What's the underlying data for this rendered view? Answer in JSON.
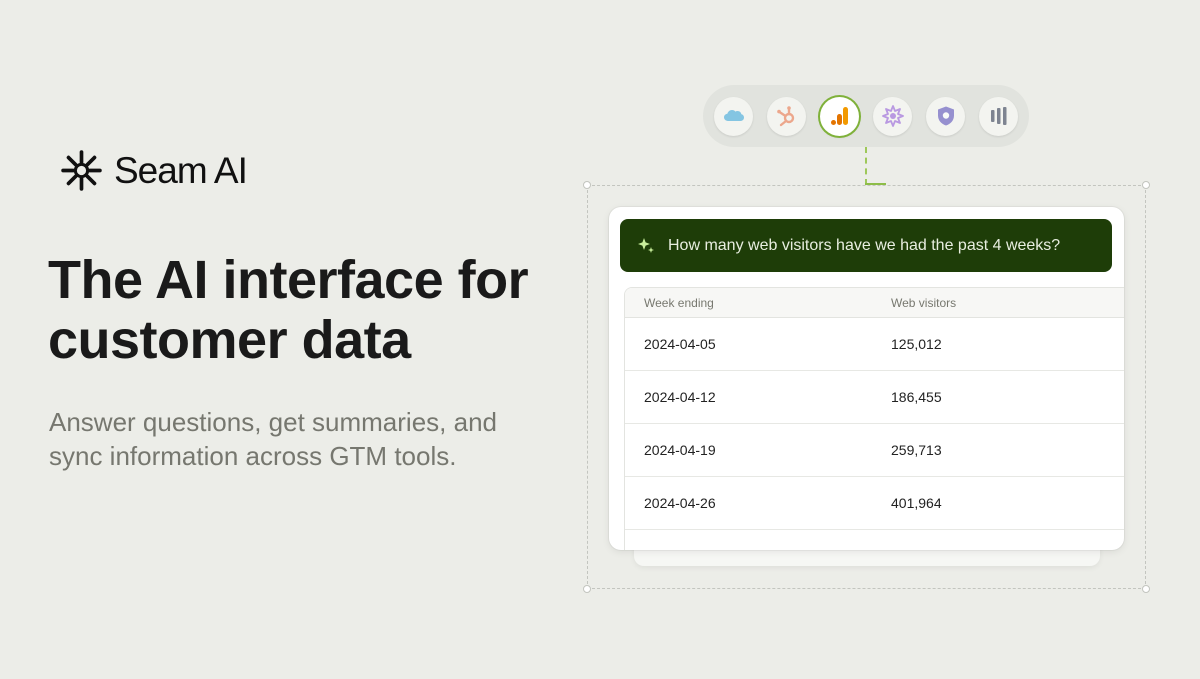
{
  "brand": {
    "name": "Seam AI",
    "logo_icon": "asterisk-burst-logo-icon"
  },
  "hero": {
    "headline": "The AI interface for customer data",
    "subline": "Answer questions, get summaries, and sync information across GTM tools."
  },
  "integrations": [
    {
      "name": "salesforce",
      "icon": "cloud-icon",
      "active": false
    },
    {
      "name": "hubspot",
      "icon": "sprocket-icon",
      "active": false
    },
    {
      "name": "google-analytics",
      "icon": "bar-chart-icon",
      "active": true
    },
    {
      "name": "integration-4",
      "icon": "starburst-icon",
      "active": false
    },
    {
      "name": "integration-5",
      "icon": "shield-icon",
      "active": false
    },
    {
      "name": "integration-6",
      "icon": "bars-icon",
      "active": false
    }
  ],
  "query": {
    "text": "How many web visitors have we had the past 4 weeks?",
    "icon": "sparkle-icon"
  },
  "table": {
    "headers": [
      "Week ending",
      "Web visitors"
    ],
    "rows": [
      [
        "2024-04-05",
        "125,012"
      ],
      [
        "2024-04-12",
        "186,455"
      ],
      [
        "2024-04-19",
        "259,713"
      ],
      [
        "2024-04-26",
        "401,964"
      ]
    ]
  },
  "colors": {
    "background": "#ecede8",
    "accent_green": "#1e3d08",
    "active_ring": "#7fb13a"
  }
}
